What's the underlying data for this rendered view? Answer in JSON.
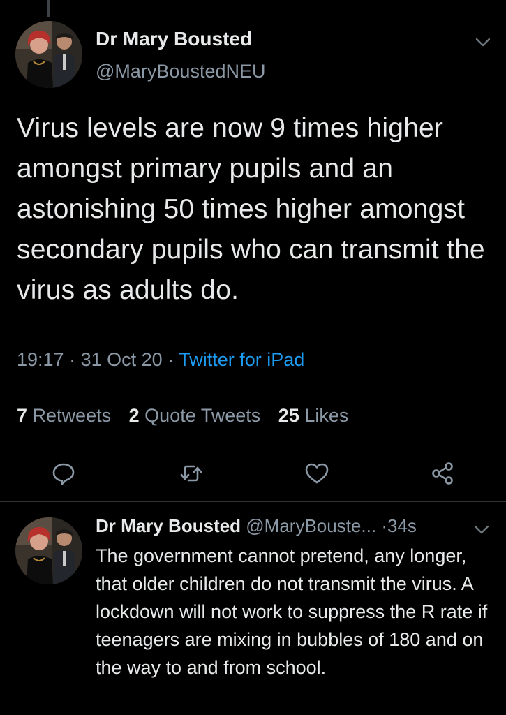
{
  "main_tweet": {
    "author_name": "Dr Mary Bousted",
    "author_handle": "@MaryBoustedNEU",
    "text": "Virus levels are now 9 times higher amongst primary pupils and an astonishing 50 times higher amongst secondary pupils who can transmit the virus as adults do.",
    "time": "19:17",
    "date": "31 Oct 20",
    "separator": "·",
    "source": "Twitter for iPad",
    "stats": {
      "retweets_count": "7",
      "retweets_label": "Retweets",
      "quotes_count": "2",
      "quotes_label": "Quote Tweets",
      "likes_count": "25",
      "likes_label": "Likes"
    },
    "actions": [
      "reply-icon",
      "retweet-icon",
      "like-icon",
      "share-icon"
    ]
  },
  "reply_tweet": {
    "author_name": "Dr Mary Bousted",
    "author_handle": "@MaryBouste...",
    "separator": "·",
    "time_ago": "34s",
    "text": "The government cannot pretend, any longer, that older children do not transmit the virus. A lockdown will not work to suppress the R rate if teenagers are mixing in bubbles of 180 and on the way to and from school."
  },
  "colors": {
    "background": "#000000",
    "primary_text": "#e7e9ea",
    "secondary_text": "#8b98a5",
    "link": "#1d9bf0",
    "divider": "#2f3336"
  }
}
